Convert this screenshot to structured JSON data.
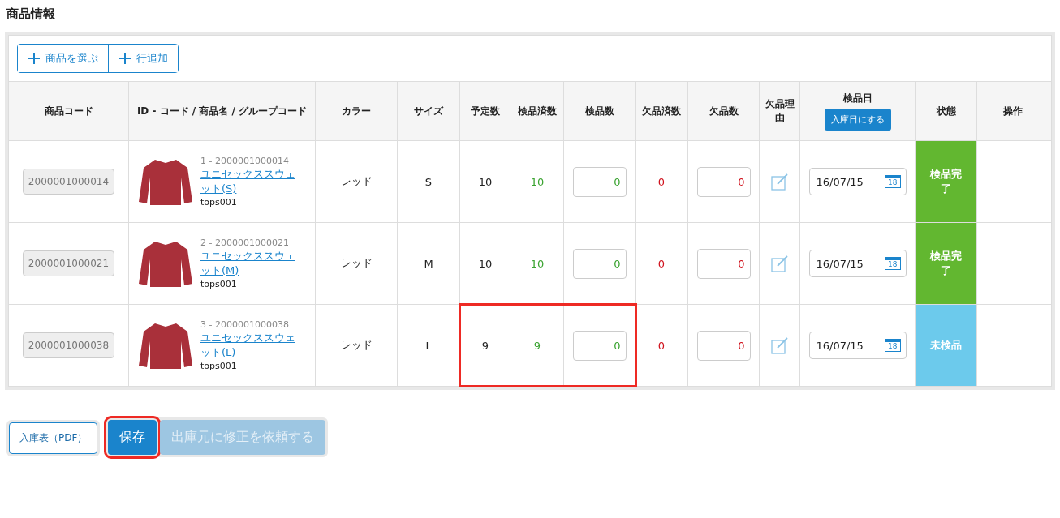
{
  "section_title": "商品情報",
  "toolbar": [
    {
      "label": "商品を選ぶ"
    },
    {
      "label": "行追加"
    }
  ],
  "table": {
    "columns": [
      "商品コード",
      "ID - コード / 商品名 / グループコード",
      "カラー",
      "サイズ",
      "予定数",
      "検品済数",
      "検品数",
      "欠品済数",
      "欠品数",
      "欠品理由",
      "検品日",
      "状態",
      "操作"
    ],
    "date_button": "入庫日にする",
    "rows": [
      {
        "code": "2000001000014",
        "id_code": "1 - 2000001000014",
        "name": "ユニセックススウェット(S)",
        "group": "tops001",
        "color_name": "レッド",
        "size": "S",
        "planned": "10",
        "inspected_done": "10",
        "inspect_qty": "0",
        "missing_done": "0",
        "missing_qty": "0",
        "date": "16/07/15",
        "calendar_day": "18",
        "status": {
          "kind": "complete",
          "label": "検品完了"
        },
        "highlighted": false
      },
      {
        "code": "2000001000021",
        "id_code": "2 - 2000001000021",
        "name": "ユニセックススウェット(M)",
        "group": "tops001",
        "color_name": "レッド",
        "size": "M",
        "planned": "10",
        "inspected_done": "10",
        "inspect_qty": "0",
        "missing_done": "0",
        "missing_qty": "0",
        "date": "16/07/15",
        "calendar_day": "18",
        "status": {
          "kind": "complete",
          "label": "検品完了"
        },
        "highlighted": false
      },
      {
        "code": "2000001000038",
        "id_code": "3 - 2000001000038",
        "name": "ユニセックススウェット(L)",
        "group": "tops001",
        "color_name": "レッド",
        "size": "L",
        "planned": "9",
        "inspected_done": "9",
        "inspect_qty": "0",
        "missing_done": "0",
        "missing_qty": "0",
        "date": "16/07/15",
        "calendar_day": "18",
        "status": {
          "kind": "pending",
          "label": "未検品"
        },
        "highlighted": true
      }
    ]
  },
  "pdf_button": "入庫表（PDF）",
  "actions": [
    {
      "label": "保存",
      "disabled": false,
      "highlighted": true
    },
    {
      "label": "出庫元に修正を依頼する",
      "disabled": true,
      "highlighted": false
    }
  ]
}
